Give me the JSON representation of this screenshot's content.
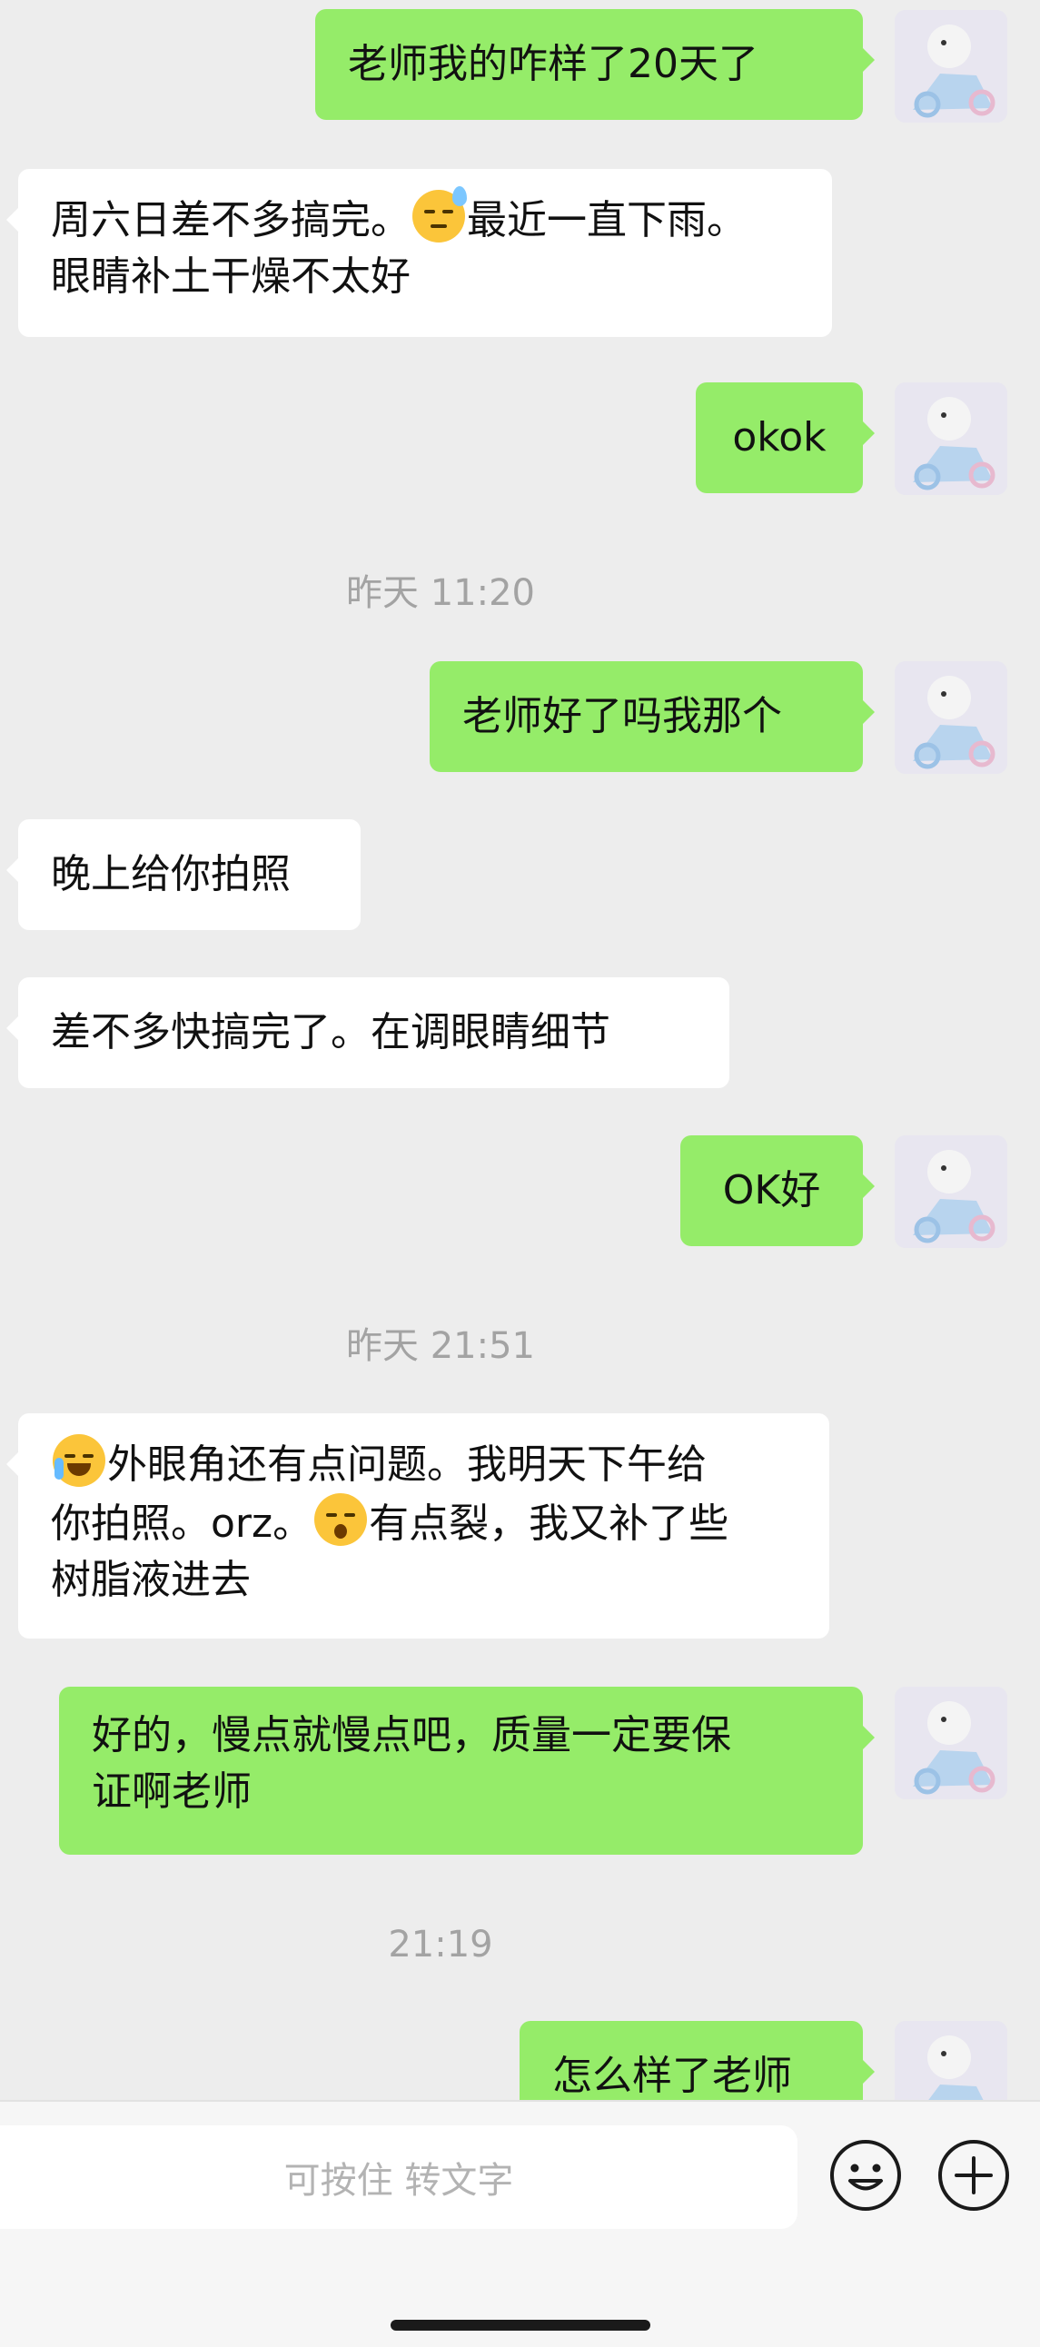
{
  "messages": [
    {
      "id": "m1",
      "side": "right",
      "text": "老师我的咋样了20天了"
    },
    {
      "id": "m2",
      "side": "left",
      "line1_a": "周六日差不多搞完。",
      "line1_b": "最近一直下雨。",
      "line2": "眼睛补土干燥不太好",
      "emoji": "sweat-emoji"
    },
    {
      "id": "m3",
      "side": "right",
      "text": "okok"
    },
    {
      "id": "m4",
      "side": "right",
      "text": "老师好了吗我那个"
    },
    {
      "id": "m5",
      "side": "left",
      "text": "晚上给你拍照"
    },
    {
      "id": "m6",
      "side": "left",
      "text": "差不多快搞完了。在调眼睛细节"
    },
    {
      "id": "m7",
      "side": "right",
      "text": "OK好"
    },
    {
      "id": "m8",
      "side": "left",
      "line1": "外眼角还有点问题。我明天下午给",
      "line2_a": "你拍照。orz。",
      "line2_b": "有点裂，我又补了些",
      "line3": "树脂液进去",
      "emoji1": "crying-laugh-emoji",
      "emoji2": "shocked-emoji"
    },
    {
      "id": "m9",
      "side": "right",
      "line1": "好的，慢点就慢点吧，质量一定要保",
      "line2": "证啊老师"
    },
    {
      "id": "m10",
      "side": "right",
      "text": "怎么样了老师"
    }
  ],
  "timestamps": [
    "昨天 11:20",
    "昨天 21:51",
    "21:19"
  ],
  "input_bar": {
    "placeholder": "可按住 转文字",
    "emoji_icon": "smiley-icon",
    "more_icon": "plus-circle-icon"
  },
  "colors": {
    "background": "#ededed",
    "sent_bubble": "#95ec69",
    "received_bubble": "#ffffff",
    "timestamp": "#a3a3a3"
  }
}
